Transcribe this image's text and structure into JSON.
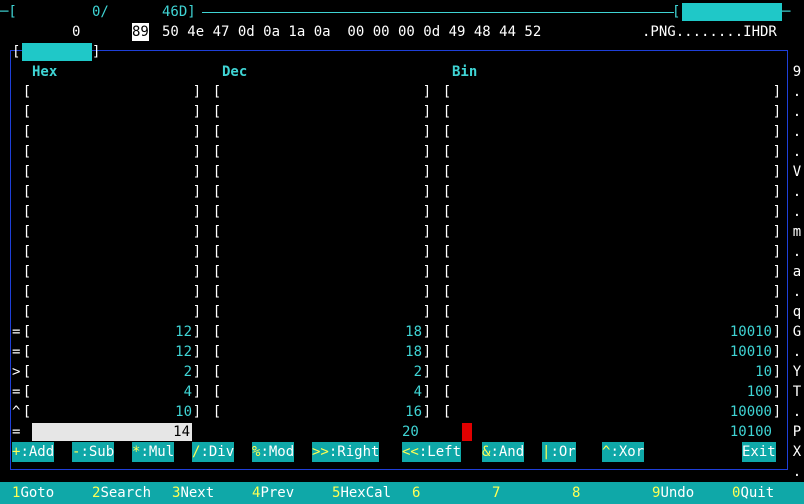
{
  "header": {
    "dash_left": "─[",
    "offset": "0/",
    "size": "46D]",
    "dash_right": "─",
    "hex_offset": "0",
    "cursor_byte": "89",
    "bytes": "50 4e 47 0d 0a 1a 0a  00 00 00 0d 49 48 44 52",
    "ascii": ".PNG........IHDR"
  },
  "calc": {
    "titles": {
      "hex": "Hex",
      "dec": "Dec",
      "bin": "Bin"
    },
    "rows": [
      {
        "mark": "=",
        "hex": "12",
        "dec": "18",
        "bin": "10010"
      },
      {
        "mark": "=",
        "hex": "12",
        "dec": "18",
        "bin": "10010"
      },
      {
        "mark": ">",
        "hex": "2",
        "dec": "2",
        "bin": "10"
      },
      {
        "mark": "=",
        "hex": "4",
        "dec": "4",
        "bin": "100"
      },
      {
        "mark": "^",
        "hex": "10",
        "dec": "16",
        "bin": "10000"
      }
    ],
    "result": {
      "mark": "=",
      "hex": "14",
      "dec": "20",
      "bin": "10100"
    }
  },
  "ops": [
    {
      "key": "+",
      "label": ":Add"
    },
    {
      "key": "-",
      "label": ":Sub"
    },
    {
      "key": "*",
      "label": ":Mul"
    },
    {
      "key": "/",
      "label": ":Div"
    },
    {
      "key": "%",
      "label": ":Mod"
    },
    {
      "key": ">>",
      "label": ":Right"
    },
    {
      "key": "<<",
      "label": ":Left"
    },
    {
      "key": "&",
      "label": ":And"
    },
    {
      "key": "|",
      "label": ":Or"
    },
    {
      "key": "^",
      "label": ":Xor"
    },
    {
      "key": "",
      "label": "Exit"
    }
  ],
  "side_ascii": [
    "9",
    ".",
    ".",
    ".",
    ".",
    "V",
    ".",
    ".",
    "m",
    ".",
    "a",
    ".",
    "q",
    "G",
    ".",
    "Y",
    "T",
    ".",
    "P",
    "X",
    "."
  ],
  "fkeys": [
    {
      "num": "1",
      "label": "Goto"
    },
    {
      "num": "2",
      "label": "Search"
    },
    {
      "num": "3",
      "label": "Next"
    },
    {
      "num": "4",
      "label": "Prev"
    },
    {
      "num": "5",
      "label": "HexCal"
    },
    {
      "num": "6",
      "label": ""
    },
    {
      "num": "7",
      "label": ""
    },
    {
      "num": "8",
      "label": ""
    },
    {
      "num": "9",
      "label": "Undo"
    },
    {
      "num": "0",
      "label": "Quit"
    }
  ],
  "colors": {
    "cyan": "#3fd4d4",
    "bar": "#0fa8a8",
    "border": "#1e3fd8",
    "cursor": "#e00000"
  }
}
